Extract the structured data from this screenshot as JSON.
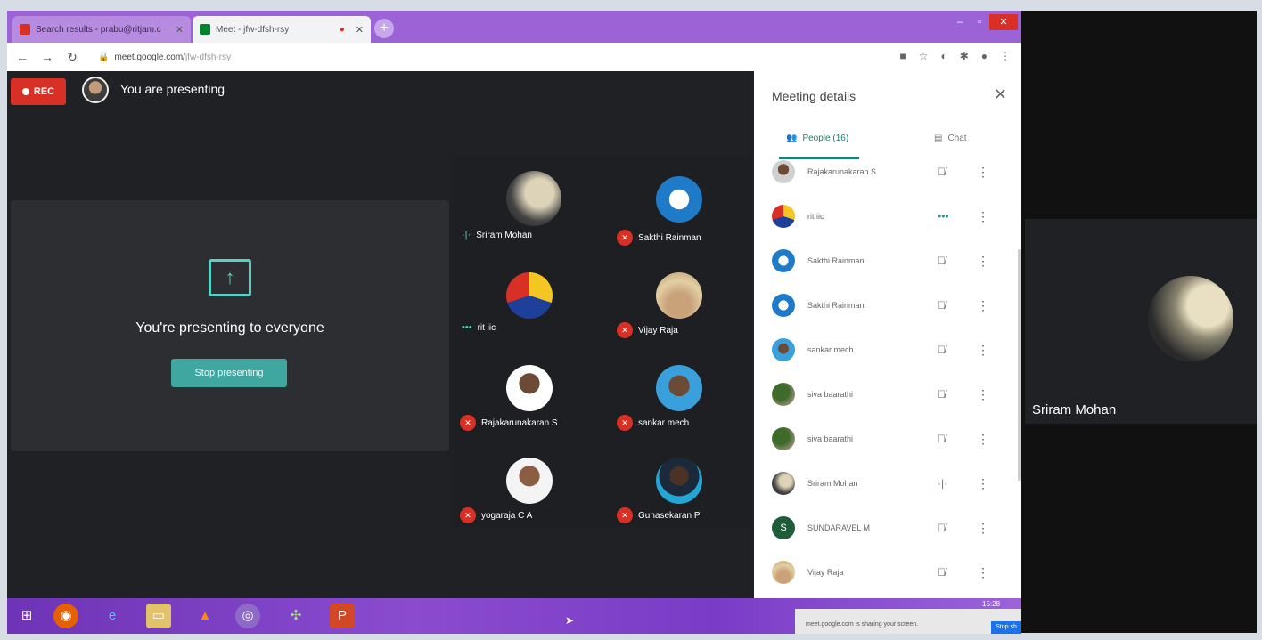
{
  "browser": {
    "tabs": [
      {
        "title": "Search results - prabu@ritjam.c",
        "close": "✕"
      },
      {
        "title": "Meet - jfw-dfsh-rsy",
        "close": "✕"
      }
    ],
    "url_host": "meet.google.com/",
    "url_path": "jfw-dfsh-rsy",
    "new_tab": "+",
    "win_min": "–",
    "win_max": "▫",
    "win_close": "✕"
  },
  "meet": {
    "rec_label": "REC",
    "presenting_label": "You are presenting",
    "present_message": "You're presenting to everyone",
    "stop_button": "Stop presenting",
    "tiles": [
      {
        "name": "Sriram Mohan",
        "mic": "on"
      },
      {
        "name": "Sakthi Rainman",
        "mic": "off"
      },
      {
        "name": "rit iic",
        "mic": "on"
      },
      {
        "name": "Vijay Raja",
        "mic": "off"
      },
      {
        "name": "Rajakarunakaran S",
        "mic": "off"
      },
      {
        "name": "sankar mech",
        "mic": "off"
      },
      {
        "name": "yogaraja C A",
        "mic": "off"
      },
      {
        "name": "Gunasekaran P",
        "mic": "off"
      }
    ]
  },
  "panel": {
    "title": "Meeting details",
    "people_tab": "People (16)",
    "chat_tab": "Chat",
    "people": [
      {
        "name": "Rajakarunakaran S",
        "mic": "off"
      },
      {
        "name": "rit iic",
        "mic": "on"
      },
      {
        "name": "Sakthi Rainman",
        "mic": "off"
      },
      {
        "name": "Sakthi Rainman",
        "mic": "off"
      },
      {
        "name": "sankar mech",
        "mic": "off"
      },
      {
        "name": "siva baarathi",
        "mic": "off"
      },
      {
        "name": "siva baarathi",
        "mic": "off"
      },
      {
        "name": "Sriram Mohan",
        "mic": "on"
      },
      {
        "name": "SUNDARAVEL M",
        "mic": "off",
        "initial": "S"
      },
      {
        "name": "Vijay Raja",
        "mic": "off"
      }
    ]
  },
  "right_video": {
    "name": "Sriram Mohan"
  },
  "taskbar": {
    "tray_text": "meet.google.com is sharing your screen.",
    "tray_button": "Stop sh",
    "clock": "15:28"
  },
  "colors": {
    "accent": "#1a7f72",
    "rec": "#d93025",
    "tabbar": "#9b63d6"
  }
}
